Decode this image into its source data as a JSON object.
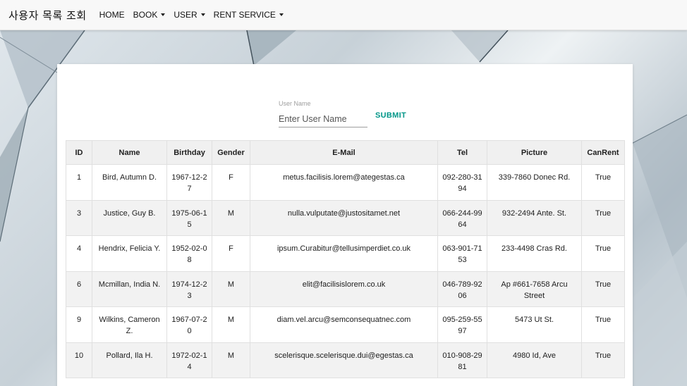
{
  "app": {
    "brand": "사용자 목록 조회"
  },
  "nav": [
    {
      "label": "HOME",
      "dropdown": false
    },
    {
      "label": "BOOK",
      "dropdown": true
    },
    {
      "label": "USER",
      "dropdown": true
    },
    {
      "label": "RENT SERVICE",
      "dropdown": true
    }
  ],
  "search": {
    "label": "User Name",
    "placeholder": "Enter User Name",
    "value": "",
    "submit_label": "SUBMIT"
  },
  "table": {
    "headers": [
      "ID",
      "Name",
      "Birthday",
      "Gender",
      "E-Mail",
      "Tel",
      "Picture",
      "CanRent"
    ],
    "rows": [
      [
        "1",
        "Bird, Autumn D.",
        "1967-12-27",
        "F",
        "metus.facilisis.lorem@ategestas.ca",
        "092-280-3194",
        "339-7860 Donec Rd.",
        "True"
      ],
      [
        "3",
        "Justice, Guy B.",
        "1975-06-15",
        "M",
        "nulla.vulputate@justositamet.net",
        "066-244-9964",
        "932-2494 Ante. St.",
        "True"
      ],
      [
        "4",
        "Hendrix, Felicia Y.",
        "1952-02-08",
        "F",
        "ipsum.Curabitur@tellusimperdiet.co.uk",
        "063-901-7153",
        "233-4498 Cras Rd.",
        "True"
      ],
      [
        "6",
        "Mcmillan, India N.",
        "1974-12-23",
        "M",
        "elit@facilisislorem.co.uk",
        "046-789-9206",
        "Ap #661-7658 Arcu Street",
        "True"
      ],
      [
        "9",
        "Wilkins, Cameron Z.",
        "1967-07-20",
        "M",
        "diam.vel.arcu@semconsequatnec.com",
        "095-259-5597",
        "5473 Ut St.",
        "True"
      ],
      [
        "10",
        "Pollard, Ila H.",
        "1972-02-14",
        "M",
        "scelerisque.scelerisque.dui@egestas.ca",
        "010-908-2981",
        "4980 Id, Ave",
        "True"
      ]
    ]
  }
}
